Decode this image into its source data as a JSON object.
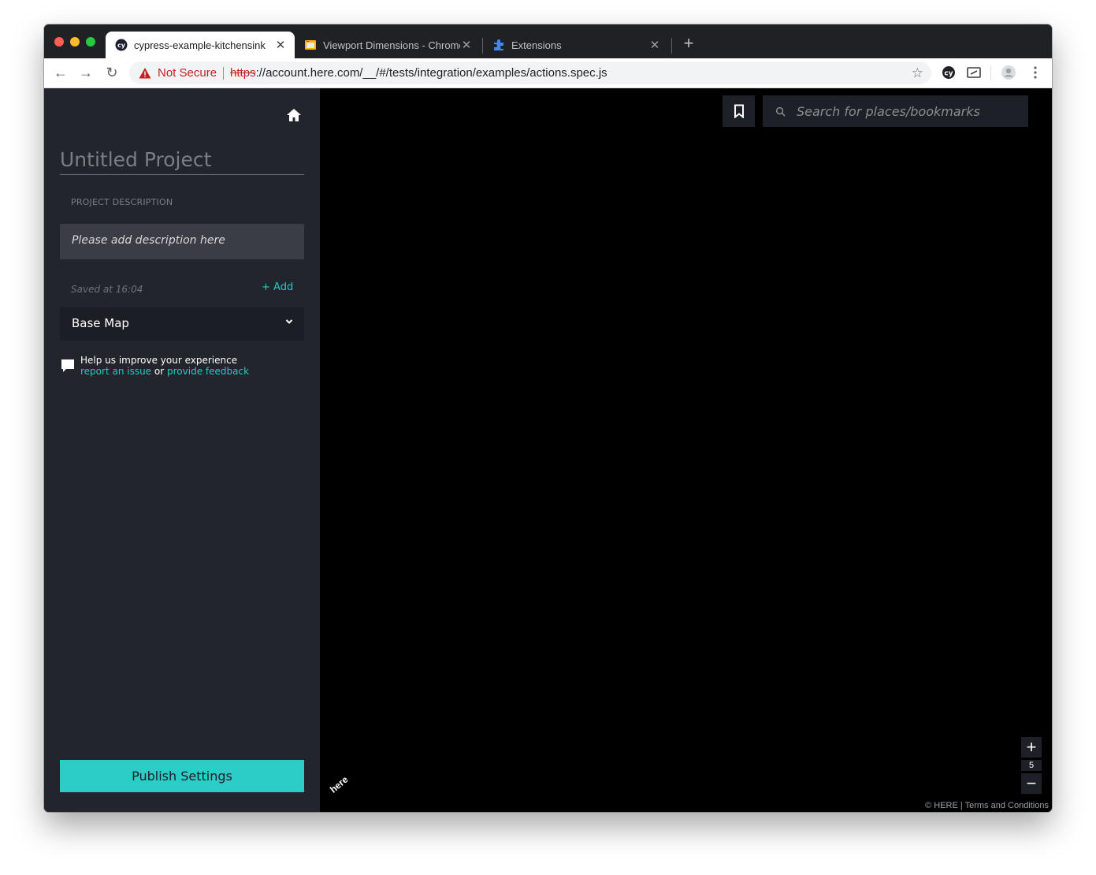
{
  "browser": {
    "tabs": [
      {
        "label": "cypress-example-kitchensink",
        "active": true,
        "icon": "cypress-icon"
      },
      {
        "label": "Viewport Dimensions - Chrome",
        "active": false,
        "icon": "viewport-icon"
      },
      {
        "label": "Extensions",
        "active": false,
        "icon": "puzzle-icon"
      }
    ],
    "address": {
      "security_label": "Not Secure",
      "scheme": "https",
      "url_rest": "://account.here.com/__/#/tests/integration/examples/actions.spec.js"
    }
  },
  "sidebar": {
    "project_title": "Untitled Project",
    "description_label": "PROJECT DESCRIPTION",
    "description_placeholder": "Please add description here",
    "saved_status": "Saved at 16:04",
    "add_label": "+ Add",
    "layer_select": "Base Map",
    "help": {
      "line1": "Help us improve your experience",
      "report_link": "report an issue",
      "or": "or",
      "feedback_link": "provide feedback"
    },
    "publish_label": "Publish Settings"
  },
  "map": {
    "search_placeholder": "Search for places/bookmarks",
    "zoom_in": "+",
    "zoom_level": "5",
    "zoom_out": "−",
    "logo": "here",
    "copyright": "© HERE | Terms and Conditions"
  },
  "colors": {
    "accent": "#2bcdc6",
    "sidebar_bg": "#22252c",
    "map_bg": "#000000",
    "warning": "#c5221f"
  }
}
